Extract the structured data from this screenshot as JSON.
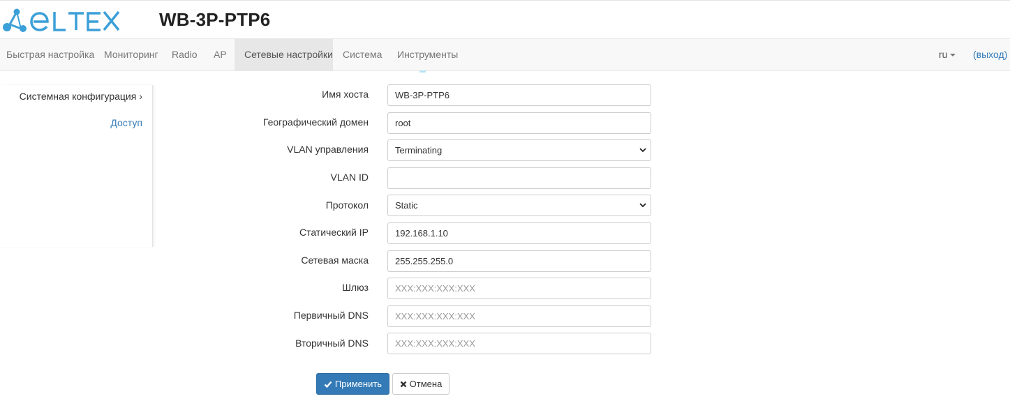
{
  "brand": {
    "logo_text": "ELTEX",
    "logo_color": "#3b9fd8",
    "device_name": "WB-3P-PTP6"
  },
  "nav": {
    "items": [
      {
        "label": "Быстрая настройка"
      },
      {
        "label": "Мониторинг"
      },
      {
        "label": "Radio"
      },
      {
        "label": "AP"
      },
      {
        "label": "Сетевые настройки",
        "active": true
      },
      {
        "label": "Система"
      },
      {
        "label": "Инструменты"
      }
    ],
    "language": "ru",
    "logout": "(выход)"
  },
  "sidebar": {
    "items": [
      {
        "label": "Системная конфигурация",
        "icon": "chevron-right-icon"
      },
      {
        "label": "Доступ"
      }
    ]
  },
  "form": {
    "hostname": {
      "label": "Имя хоста",
      "value": "WB-3P-PTP6"
    },
    "geo_domain": {
      "label": "Географический домен",
      "value": "root"
    },
    "vlan_mgmt": {
      "label": "VLAN управления",
      "value": "Terminating"
    },
    "vlan_id": {
      "label": "VLAN ID",
      "value": ""
    },
    "protocol": {
      "label": "Протокол",
      "value": "Static"
    },
    "static_ip": {
      "label": "Статический IP",
      "value": "192.168.1.10"
    },
    "netmask": {
      "label": "Сетевая маска",
      "value": "255.255.255.0"
    },
    "gateway": {
      "label": "Шлюз",
      "value": "",
      "placeholder": "XXX:XXX:XXX:XXX"
    },
    "dns1": {
      "label": "Первичный DNS",
      "value": "",
      "placeholder": "XXX:XXX:XXX:XXX"
    },
    "dns2": {
      "label": "Вторичный DNS",
      "value": "",
      "placeholder": "XXX:XXX:XXX:XXX"
    }
  },
  "buttons": {
    "apply": "Применить",
    "cancel": "Отмена"
  },
  "colors": {
    "primary": "#337ab7",
    "link": "#337ab7",
    "navbar_bg": "#f8f8f8",
    "nav_active_bg": "#e7e7e7"
  }
}
